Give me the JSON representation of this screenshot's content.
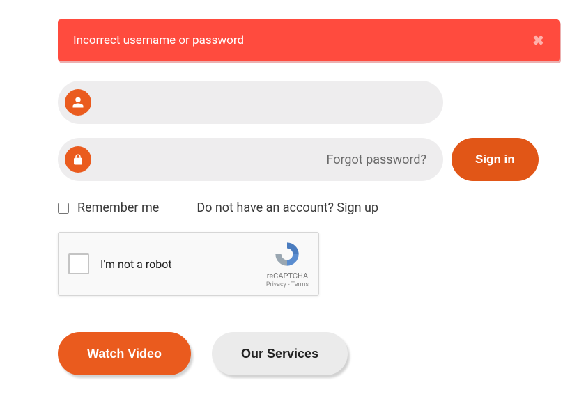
{
  "alert": {
    "message": "Incorrect username or password",
    "close_glyph": "✖"
  },
  "username": {
    "value": "",
    "placeholder": ""
  },
  "password": {
    "value": "",
    "placeholder": "",
    "forgot_label": "Forgot password?",
    "signin_label": "Sign in"
  },
  "remember": {
    "label": "Remember me"
  },
  "signup": {
    "text": "Do not have an account? Sign up"
  },
  "recaptcha": {
    "label": "I'm not a robot",
    "brand": "reCAPTCHA",
    "terms": "Privacy  -  Terms"
  },
  "buttons": {
    "watch_video": "Watch Video",
    "our_services": "Our Services"
  }
}
